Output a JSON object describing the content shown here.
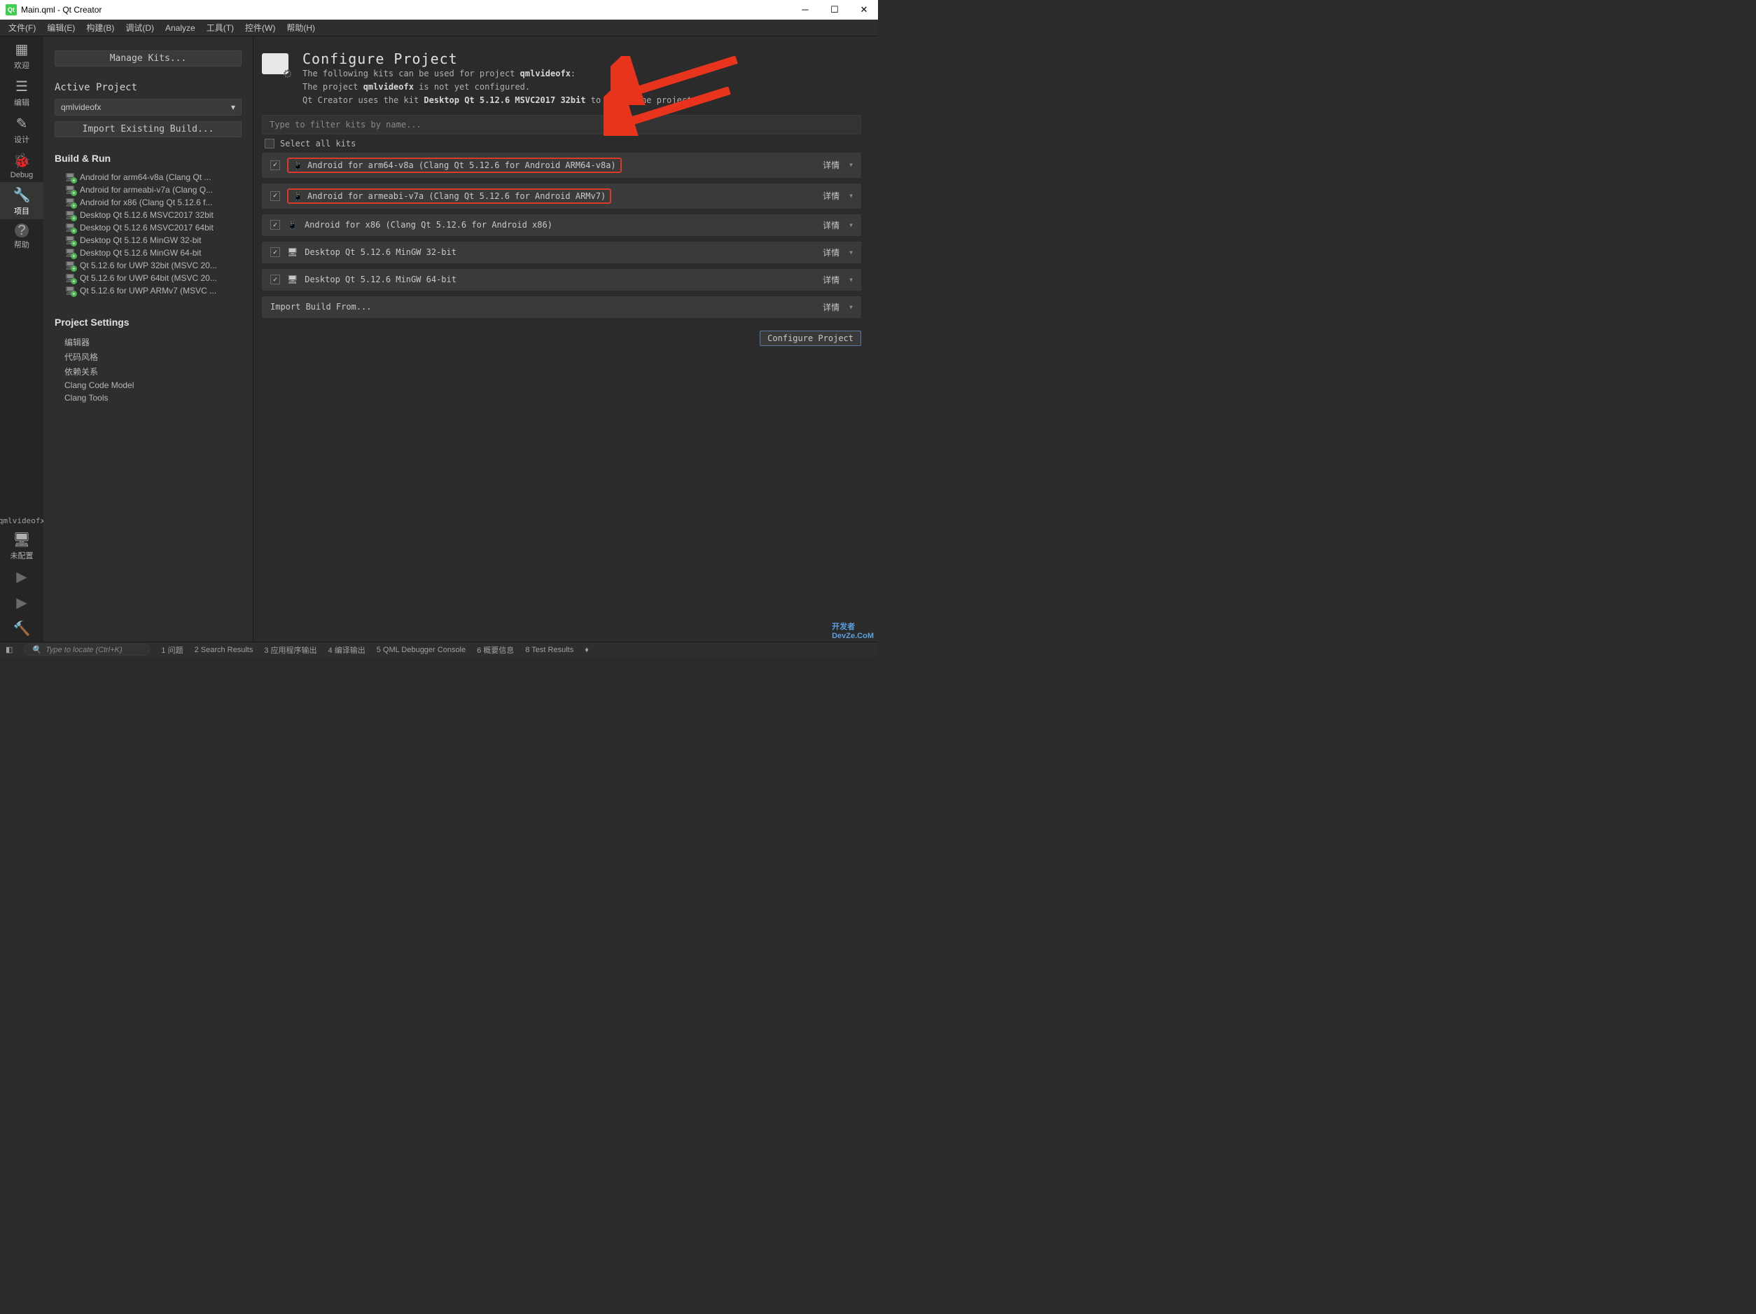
{
  "title": "Main.qml - Qt Creator",
  "menubar": [
    "文件(F)",
    "编辑(E)",
    "构建(B)",
    "调试(D)",
    "Analyze",
    "工具(T)",
    "控件(W)",
    "帮助(H)"
  ],
  "rail": {
    "items": [
      {
        "icon": "⊞",
        "label": "欢迎"
      },
      {
        "icon": "≡",
        "label": "编辑"
      },
      {
        "icon": "✎",
        "label": "设计"
      },
      {
        "icon": "🐞",
        "label": "Debug"
      },
      {
        "icon": "🔧",
        "label": "项目",
        "active": true
      },
      {
        "icon": "?",
        "label": "帮助"
      }
    ],
    "project": "qmlvideofx",
    "monitor_label": "未配置"
  },
  "sidebar": {
    "manage_kits": "Manage Kits...",
    "active_project_head": "Active Project",
    "project_name": "qmlvideofx",
    "import_build": "Import Existing Build...",
    "build_run": "Build & Run",
    "kits": [
      "Android for arm64-v8a (Clang Qt ...",
      "Android for armeabi-v7a (Clang Q...",
      "Android for x86 (Clang Qt 5.12.6 f...",
      "Desktop Qt 5.12.6 MSVC2017 32bit",
      "Desktop Qt 5.12.6 MSVC2017 64bit",
      "Desktop Qt 5.12.6 MinGW 32-bit",
      "Desktop Qt 5.12.6 MinGW 64-bit",
      "Qt 5.12.6 for UWP 32bit (MSVC 20...",
      "Qt 5.12.6 for UWP 64bit (MSVC 20...",
      "Qt 5.12.6 for UWP ARMv7 (MSVC ..."
    ],
    "project_settings": "Project Settings",
    "ps_items": [
      "编辑器",
      "代码风格",
      "依赖关系",
      "Clang Code Model",
      "Clang Tools"
    ]
  },
  "content": {
    "title": "Configure Project",
    "line1a": "The following kits can be used for project ",
    "line1b": "qmlvideofx",
    "line1c": ":",
    "line2a": "The project ",
    "line2b": "qmlvideofx",
    "line2c": " is not yet configured.",
    "line3a": "Qt Creator uses the kit ",
    "line3b": "Desktop Qt 5.12.6 MSVC2017 32bit",
    "line3c": " to parse the project.",
    "filter_placeholder": "Type to filter kits by name...",
    "select_all": "Select all kits",
    "kits": [
      {
        "label": "Android for arm64-v8a (Clang Qt 5.12.6 for Android ARM64-v8a)",
        "icon": "📱",
        "hl": true
      },
      {
        "label": "Android for armeabi-v7a (Clang Qt 5.12.6 for Android ARMv7)",
        "icon": "📱",
        "hl": true
      },
      {
        "label": "Android for x86 (Clang Qt 5.12.6 for Android x86)",
        "icon": "📱",
        "hl": false
      },
      {
        "label": "Desktop Qt 5.12.6 MinGW 32-bit",
        "icon": "🖥",
        "hl": false
      },
      {
        "label": "Desktop Qt 5.12.6 MinGW 64-bit",
        "icon": "🖥",
        "hl": false
      }
    ],
    "import_build": "Import Build From...",
    "detail": "详情",
    "configure_btn": "Configure Project"
  },
  "statusbar": {
    "search_placeholder": "Type to locate (Ctrl+K)",
    "items": [
      "1  问题",
      "2  Search Results",
      "3  应用程序输出",
      "4  编译输出",
      "5  QML Debugger Console",
      "6  概要信息",
      "8  Test Results"
    ]
  },
  "watermark": "开发者\nDevZe.CoM"
}
